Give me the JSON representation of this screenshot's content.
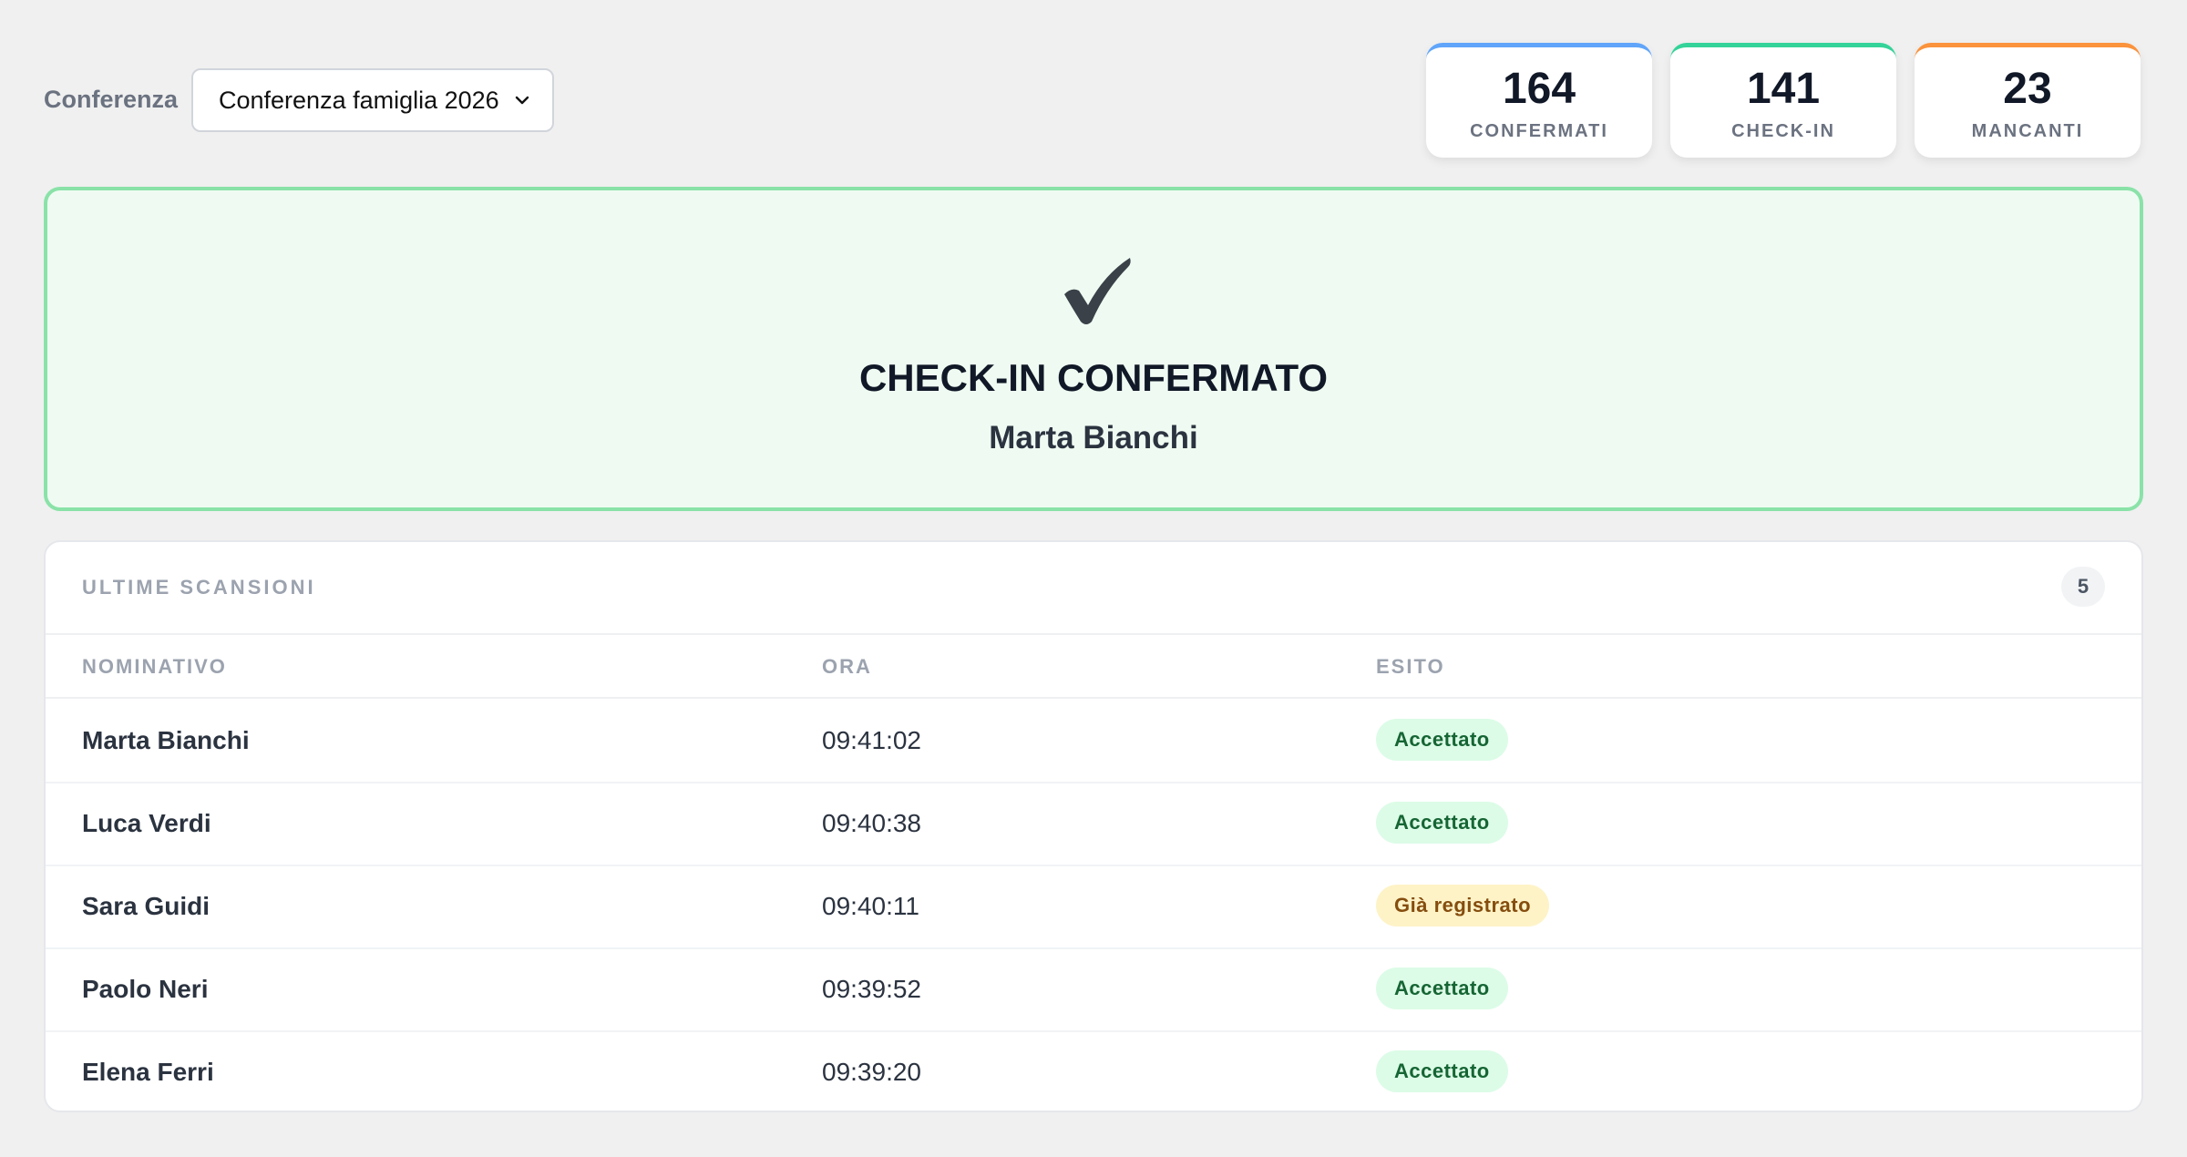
{
  "header": {
    "conference_label": "Conferenza",
    "conference_select": {
      "selected": "Conferenza famiglia 2026"
    },
    "stats": [
      {
        "value": "164",
        "label": "CONFERMATI",
        "accent": "#60a5fa"
      },
      {
        "value": "141",
        "label": "CHECK-IN",
        "accent": "#34d399"
      },
      {
        "value": "23",
        "label": "MANCANTI",
        "accent": "#fb923c"
      }
    ]
  },
  "result": {
    "icon": "check-mark-icon",
    "title": "CHECK-IN CONFERMATO",
    "name": "Marta Bianchi",
    "color": "#8ae2a8"
  },
  "scans": {
    "title": "ULTIME SCANSIONI",
    "count": "5",
    "columns": [
      "NOMINATIVO",
      "ORA",
      "ESITO"
    ],
    "rows": [
      {
        "name": "Marta Bianchi",
        "time": "09:41:02",
        "status": "Accettato"
      },
      {
        "name": "Luca Verdi",
        "time": "09:40:38",
        "status": "Accettato"
      },
      {
        "name": "Sara Guidi",
        "time": "09:40:11",
        "status": "Già registrato"
      },
      {
        "name": "Paolo Neri",
        "time": "09:39:52",
        "status": "Accettato"
      },
      {
        "name": "Elena Ferri",
        "time": "09:39:20",
        "status": "Accettato"
      }
    ]
  }
}
